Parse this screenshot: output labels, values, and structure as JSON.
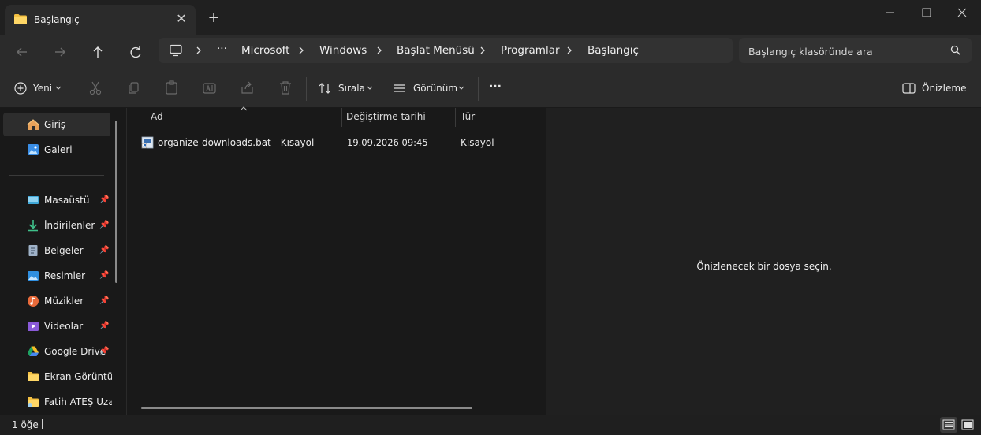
{
  "tab": {
    "title": "Başlangıç",
    "close": "✕",
    "new": "+"
  },
  "window_controls": {
    "minimize": "—",
    "maximize": "☐",
    "close": "✕"
  },
  "address": {
    "ellipsis": "···",
    "crumbs": [
      "Microsoft",
      "Windows",
      "Başlat Menüsü",
      "Programlar",
      "Başlangıç"
    ]
  },
  "search": {
    "placeholder": "Başlangıç klasöründe ara"
  },
  "toolbar": {
    "new_label": "Yeni",
    "sort_label": "Sırala",
    "view_label": "Görünüm",
    "more_label": "···",
    "preview_label": "Önizleme"
  },
  "sidebar": {
    "items": [
      {
        "label": "Giriş",
        "icon": "home-icon",
        "pinned": false
      },
      {
        "label": "Galeri",
        "icon": "gallery-icon",
        "pinned": false
      },
      {
        "label": "Masaüstü",
        "icon": "desktop-icon",
        "pinned": true
      },
      {
        "label": "İndirilenler",
        "icon": "download-icon",
        "pinned": true
      },
      {
        "label": "Belgeler",
        "icon": "documents-icon",
        "pinned": true
      },
      {
        "label": "Resimler",
        "icon": "pictures-icon",
        "pinned": true
      },
      {
        "label": "Müzikler",
        "icon": "music-icon",
        "pinned": true
      },
      {
        "label": "Videolar",
        "icon": "videos-icon",
        "pinned": true
      },
      {
        "label": "Google Drive",
        "icon": "google-drive-icon",
        "pinned": true
      },
      {
        "label": "Ekran Görüntüleri",
        "icon": "folder-icon",
        "pinned": false
      },
      {
        "label": "Fatih ATEŞ Uzak",
        "icon": "folder-icon",
        "pinned": false
      }
    ]
  },
  "columns": {
    "name": "Ad",
    "modified": "Değiştirme tarihi",
    "type": "Tür"
  },
  "files": [
    {
      "name": "organize-downloads.bat - Kısayol",
      "modified": "19.09.2026 09:45",
      "type": "Kısayol"
    }
  ],
  "preview": {
    "message": "Önizlenecek bir dosya seçin."
  },
  "status": {
    "count": "1 öğe"
  },
  "colors": {
    "accent": "#4cc2ff",
    "folder": "#f4c042",
    "background": "#191919"
  }
}
